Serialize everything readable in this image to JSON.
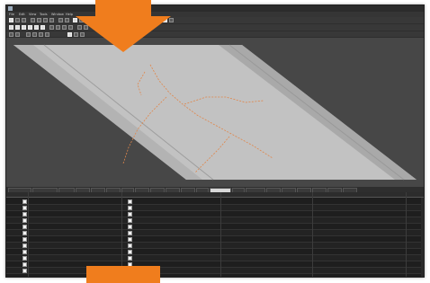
{
  "app": {
    "title": ""
  },
  "menu": [
    "File",
    "Edit",
    "View",
    "Tools",
    "Window",
    "Help"
  ],
  "viewport": {
    "colors": {
      "background": "#474747",
      "sheet": "#c2c2c2",
      "stripe": "#a9a9a9",
      "crack": "#e0864a"
    }
  },
  "tabs": [
    "",
    "",
    "",
    "",
    "",
    "",
    "",
    "",
    "",
    "",
    "",
    "",
    "",
    "",
    "",
    "",
    "",
    "",
    "",
    "",
    ""
  ],
  "active_tab_index": 11,
  "grid": {
    "headers": [
      "",
      "",
      "",
      "",
      "",
      "",
      ""
    ],
    "rows": [
      [
        "",
        "",
        "",
        "",
        "",
        "",
        ""
      ],
      [
        "",
        "",
        "",
        "",
        "",
        "",
        ""
      ],
      [
        "",
        "",
        "",
        "",
        "",
        "",
        ""
      ],
      [
        "",
        "",
        "",
        "",
        "",
        "",
        ""
      ],
      [
        "",
        "",
        "",
        "",
        "",
        "",
        ""
      ],
      [
        "",
        "",
        "",
        "",
        "",
        "",
        ""
      ],
      [
        "",
        "",
        "",
        "",
        "",
        "",
        ""
      ],
      [
        "",
        "",
        "",
        "",
        "",
        "",
        ""
      ],
      [
        "",
        "",
        "",
        "",
        "",
        "",
        ""
      ],
      [
        "",
        "",
        "",
        "",
        "",
        "",
        ""
      ],
      [
        "",
        "",
        "",
        "",
        "",
        "",
        ""
      ],
      [
        "",
        "",
        "",
        "",
        "",
        "",
        ""
      ]
    ]
  },
  "annotations": {
    "arrow_color": "#f07d1d"
  }
}
